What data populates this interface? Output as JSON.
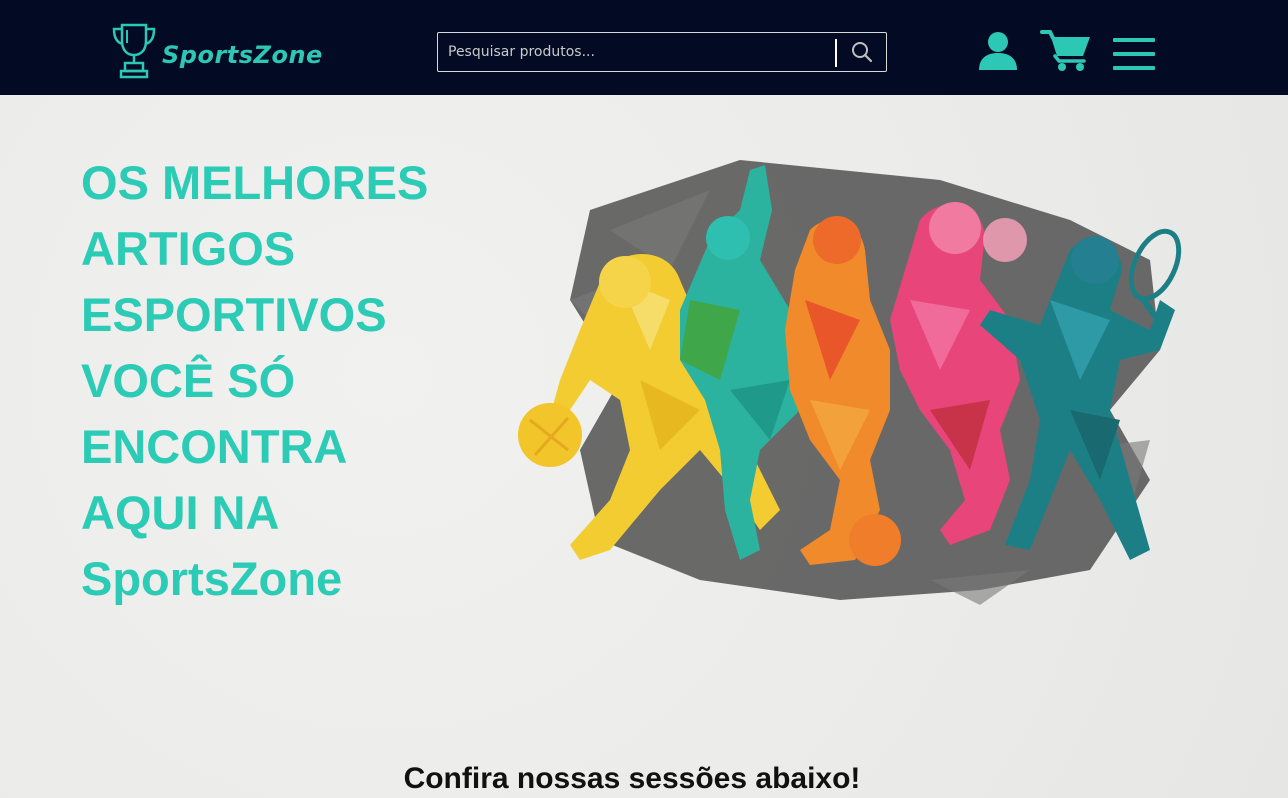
{
  "header": {
    "brand_name": "SportsZone",
    "logo_icon": "trophy-icon",
    "search": {
      "placeholder": "Pesquisar produtos...",
      "value": "",
      "icon": "search-icon"
    },
    "icons": [
      "user-icon",
      "cart-icon",
      "menu-icon"
    ],
    "colors": {
      "background": "#030b24",
      "accent": "#2cc8b5"
    }
  },
  "hero": {
    "title_lines": [
      "OS MELHORES",
      "ARTIGOS",
      "ESPORTIVOS",
      "VOCÊ SÓ",
      "ENCONTRA",
      "AQUI NA",
      "SportsZone"
    ],
    "illustration": "colorful-athletes-illustration",
    "colors": {
      "title": "#2ccbb6"
    }
  },
  "sections": {
    "heading": "Confira nossas sessões abaixo!"
  }
}
